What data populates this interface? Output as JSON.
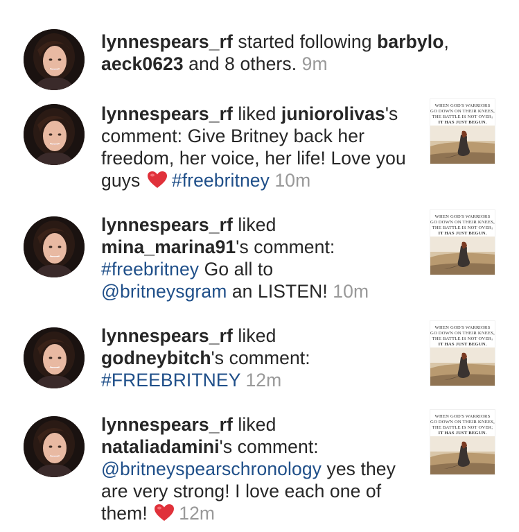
{
  "colors": {
    "text": "#262626",
    "username": "#262626",
    "hashtag_link": "#1f4f89",
    "timestamp": "#999999",
    "heart": "#e0313a"
  },
  "notifications": [
    {
      "id": "follow",
      "actor": "lynnespears_rf",
      "action": " started following ",
      "target1": "barbylo",
      "sep": ",",
      "target2": "aeck0623",
      "rest": " and 8 others.",
      "time": "9m"
    },
    {
      "id": "like-juniorolivas",
      "actor": "lynnespears_rf",
      "action": " liked ",
      "commenter": "juniorolivas",
      "possessive": "'s comment: ",
      "comment": "Give Britney back her freedom, her voice, her life! Love you guys",
      "emoji": "heart",
      "hashtag": "#freebritney",
      "time": "10m",
      "thumb_lines": [
        "WHEN GOD'S WARRIORS",
        "GO DOWN ON THEIR KNEES,",
        "THE BATTLE IS NOT OVER;",
        "IT HAS JUST BEGUN."
      ]
    },
    {
      "id": "like-mina",
      "actor": "lynnespears_rf",
      "action": " liked ",
      "commenter": "mina_marina91",
      "possessive": "'s comment: ",
      "hashtag": "#freebritney",
      "comment_part": " Go all to ",
      "mention": "@britneysgram",
      "comment_tail": " an LISTEN!",
      "time": "10m",
      "thumb_lines": [
        "WHEN GOD'S WARRIORS",
        "GO DOWN ON THEIR KNEES,",
        "THE BATTLE IS NOT OVER;",
        "IT HAS JUST BEGUN."
      ]
    },
    {
      "id": "like-godney",
      "actor": "lynnespears_rf",
      "action": " liked ",
      "commenter": "godneybitch",
      "possessive": "'s comment: ",
      "hashtag": "#FREEBRITNEY",
      "time": "12m",
      "thumb_lines": [
        "WHEN GOD'S WARRIORS",
        "GO DOWN ON THEIR KNEES,",
        "THE BATTLE IS NOT OVER;",
        "IT HAS JUST BEGUN."
      ]
    },
    {
      "id": "like-natalia",
      "actor": "lynnespears_rf",
      "action": " liked ",
      "commenter": "nataliadamini",
      "possessive": "'s comment: ",
      "mention": "@britneyspearschronology",
      "comment": " yes they are very strong! I love each one of them!",
      "emoji": "heart",
      "time": "12m",
      "thumb_lines": [
        "WHEN GOD'S WARRIORS",
        "GO DOWN ON THEIR KNEES,",
        "THE BATTLE IS NOT OVER;",
        "IT HAS JUST BEGUN."
      ]
    }
  ]
}
